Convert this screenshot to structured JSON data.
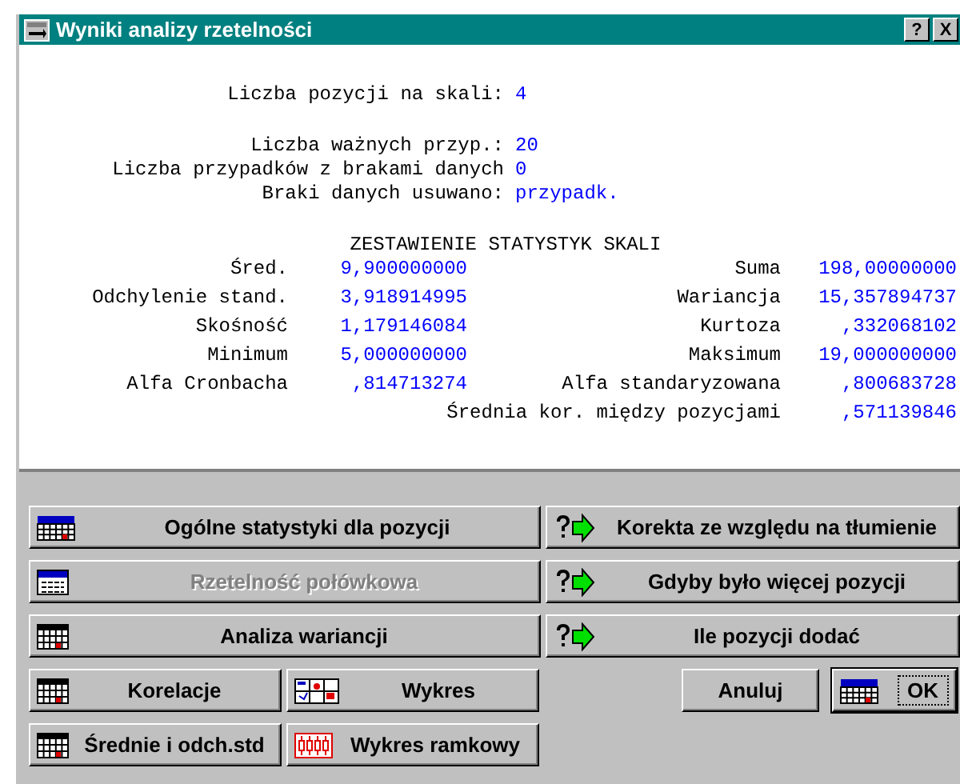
{
  "window": {
    "title": "Wyniki analizy rzetelności",
    "title_buttons": [
      "?",
      "X"
    ]
  },
  "scale_info": [
    [
      {
        "label": "Liczba pozycji na skali:",
        "value": "4"
      }
    ],
    [
      {
        "label": "Liczba ważnych przyp.:",
        "value": "20"
      },
      {
        "label": "Liczba przypadków z brakami danych",
        "value": "0"
      },
      {
        "label": "Braki danych usuwano:",
        "value": "przypadk."
      }
    ]
  ],
  "stats": {
    "title": "ZESTAWIENIE STATYSTYK SKALI",
    "rows": [
      {
        "label": "Śred.",
        "value": "9,900000000",
        "label_2": "Suma",
        "value_2": "198,00000000"
      },
      {
        "label": "Odchylenie stand.",
        "value": "3,918914995",
        "label_2": "Wariancja",
        "value_2": "15,357894737"
      },
      {
        "label": "Skośność",
        "value": "1,179146084",
        "label_2": "Kurtoza",
        "value_2": ",332068102"
      },
      {
        "label": "Minimum",
        "value": "5,000000000",
        "label_2": "Maksimum",
        "value_2": "19,000000000"
      },
      {
        "label": "Alfa Cronbacha",
        "value": ",814713274",
        "label_2": "Alfa standaryzowana",
        "value_2": ",800683728"
      },
      {
        "label_2": "Średnia kor. między pozycjami",
        "value_2": ",571139846"
      }
    ]
  },
  "button_rows": [
    {
      "left": [
        {
          "label": "Ogólne statystyki dla pozycji",
          "kind": "summ",
          "disabled": false,
          "default": false
        }
      ],
      "right": [
        {
          "label": "Korekta ze względu na tłumienie",
          "kind": "hint",
          "disabled": false,
          "default": false
        }
      ]
    },
    {
      "left": [
        {
          "label": "Rzetelność połówkowa",
          "kind": "form",
          "disabled": true,
          "default": false
        }
      ],
      "right": [
        {
          "label": "Gdyby było więcej pozycji",
          "kind": "hint",
          "disabled": false,
          "default": false
        }
      ]
    },
    {
      "left": [
        {
          "label": "Analiza wariancji",
          "kind": "grid",
          "disabled": false,
          "default": false
        }
      ],
      "right": [
        {
          "label": "Ile pozycji dodać",
          "kind": "hint",
          "disabled": false,
          "default": false
        }
      ]
    },
    {
      "left": [
        {
          "label": "Korelacje",
          "kind": "grid",
          "disabled": false,
          "default": false
        },
        {
          "label": "Wykres",
          "kind": "plot",
          "disabled": false,
          "default": false
        }
      ],
      "right": [
        {
          "label": "Anuluj",
          "kind": "plain",
          "disabled": false,
          "default": false
        },
        {
          "label": "OK",
          "kind": "summ",
          "disabled": false,
          "default": true
        }
      ]
    },
    {
      "left": [
        {
          "label": "Średnie i odch.std",
          "kind": "grid",
          "disabled": false,
          "default": false
        },
        {
          "label": "Wykres ramkowy",
          "kind": "boxplot",
          "disabled": false,
          "default": false
        }
      ],
      "right": []
    }
  ]
}
